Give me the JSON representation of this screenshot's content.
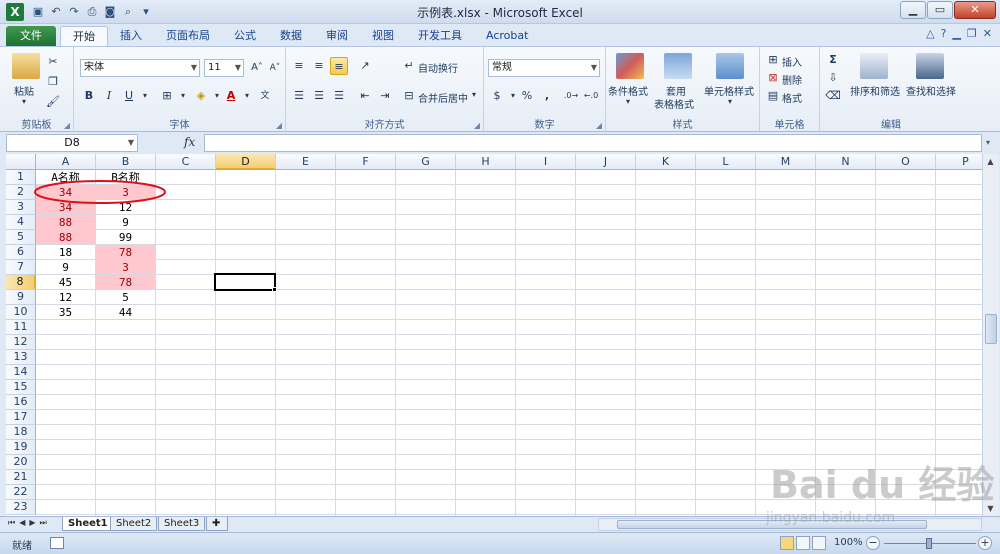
{
  "window": {
    "title": "示例表.xlsx - Microsoft Excel"
  },
  "ribbon_tabs": [
    "文件",
    "开始",
    "插入",
    "页面布局",
    "公式",
    "数据",
    "审阅",
    "视图",
    "开发工具",
    "Acrobat"
  ],
  "clipboard": {
    "paste": "粘贴",
    "label": "剪贴板"
  },
  "font": {
    "name": "宋体",
    "size": "11",
    "label": "字体",
    "bold": "B",
    "italic": "I",
    "underline": "U"
  },
  "alignment": {
    "wrap": "自动换行",
    "merge": "合并后居中",
    "label": "对齐方式"
  },
  "number": {
    "format": "常规",
    "percent": "%",
    "comma": ",",
    "label": "数字"
  },
  "styles": {
    "conditional": "条件格式",
    "table_line1": "套用",
    "table_line2": "表格格式",
    "cell_styles": "单元格样式",
    "label": "样式"
  },
  "cells": {
    "insert": "插入",
    "delete": "删除",
    "format": "格式",
    "label": "单元格"
  },
  "editing": {
    "sort": "排序和筛选",
    "find": "查找和选择",
    "label": "编辑"
  },
  "formula_bar": {
    "name_box": "D8",
    "fx": "fx",
    "value": ""
  },
  "grid": {
    "columns": [
      "A",
      "B",
      "C",
      "D",
      "E",
      "F",
      "G",
      "H",
      "I",
      "J",
      "K",
      "L",
      "M",
      "N",
      "O",
      "P"
    ],
    "rows": [
      "1",
      "2",
      "3",
      "4",
      "5",
      "6",
      "7",
      "8",
      "9",
      "10",
      "11",
      "12",
      "13",
      "14",
      "15",
      "16",
      "17",
      "18",
      "19",
      "20",
      "21",
      "22",
      "23"
    ],
    "active_cell": "D8",
    "data": [
      {
        "a": "A名称",
        "b": "B名称",
        "a_hl": false,
        "b_hl": false
      },
      {
        "a": "34",
        "b": "3",
        "a_hl": true,
        "b_hl": true
      },
      {
        "a": "34",
        "b": "12",
        "a_hl": true,
        "b_hl": false
      },
      {
        "a": "88",
        "b": "9",
        "a_hl": true,
        "b_hl": false
      },
      {
        "a": "88",
        "b": "99",
        "a_hl": true,
        "b_hl": false
      },
      {
        "a": "18",
        "b": "78",
        "a_hl": false,
        "b_hl": true
      },
      {
        "a": "9",
        "b": "3",
        "a_hl": false,
        "b_hl": true
      },
      {
        "a": "45",
        "b": "78",
        "a_hl": false,
        "b_hl": true
      },
      {
        "a": "12",
        "b": "5",
        "a_hl": false,
        "b_hl": false
      },
      {
        "a": "35",
        "b": "44",
        "a_hl": false,
        "b_hl": false
      }
    ],
    "highlight_fill": "#ffc7ce",
    "highlight_text": "#9c0006",
    "annotation_color": "#e0101a"
  },
  "sheets": [
    "Sheet1",
    "Sheet2",
    "Sheet3"
  ],
  "status": {
    "ready": "就绪",
    "zoom": "100%"
  },
  "watermark": {
    "logo": "Bai du 经验",
    "url": "jingyan.baidu.com"
  }
}
